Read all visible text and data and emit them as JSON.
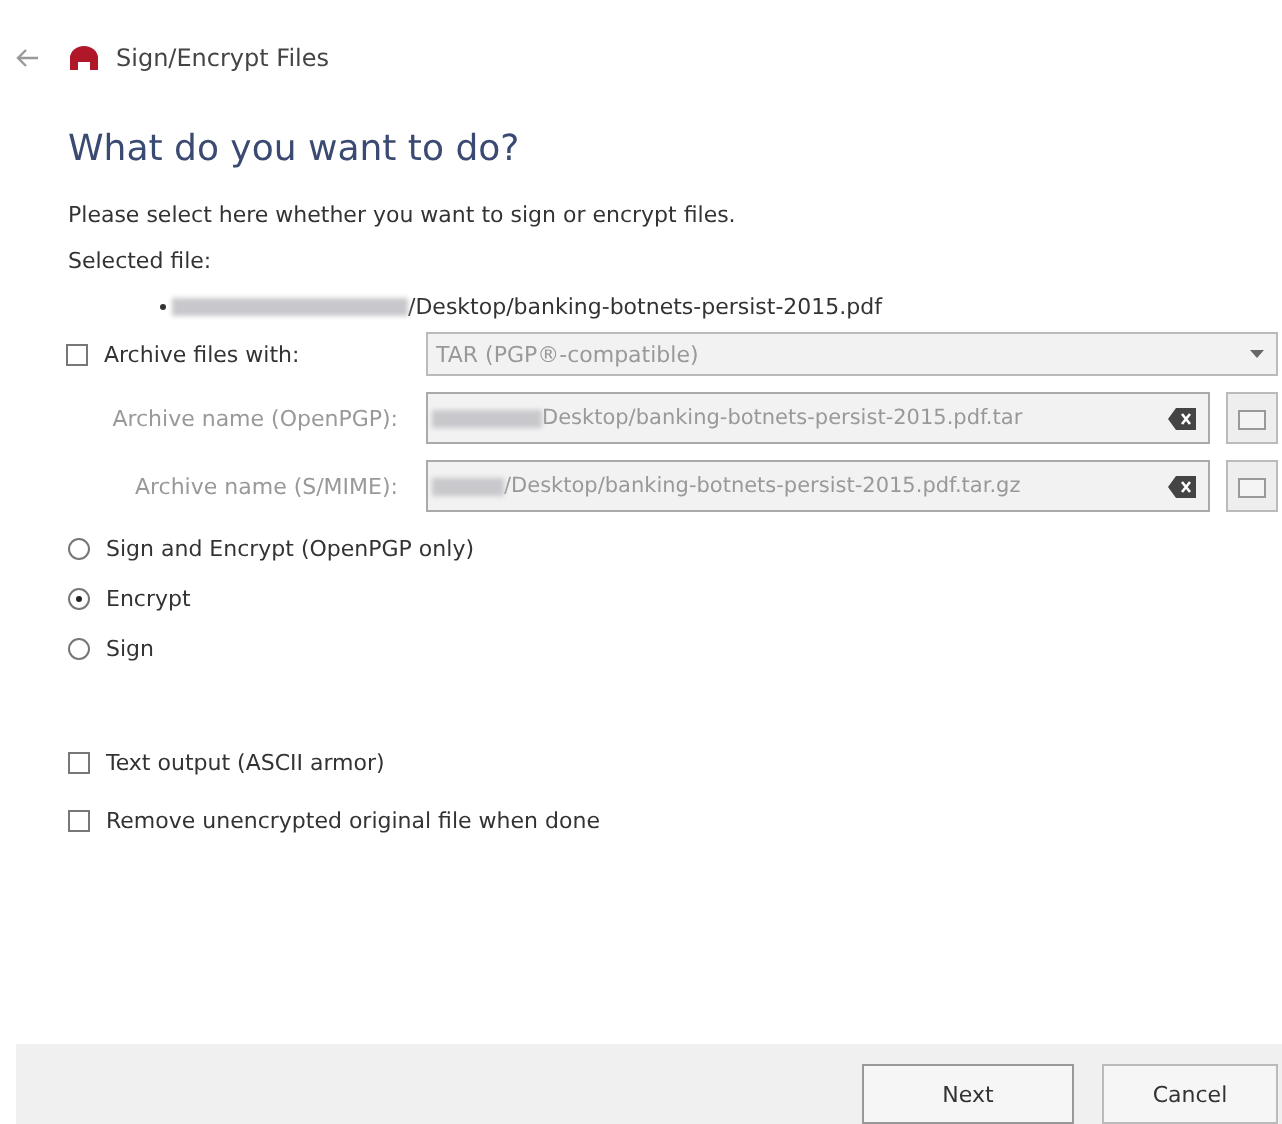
{
  "window": {
    "title": "Sign/Encrypt Files"
  },
  "heading": "What do you want to do?",
  "intro": "Please select here whether you want to sign or encrypt files.",
  "selected_file_label": "Selected file:",
  "selected_files": [
    "/Desktop/banking-botnets-persist-2015.pdf"
  ],
  "archive": {
    "label": "Archive files with:",
    "checked": false,
    "format": "TAR (PGP®-compatible)",
    "disabled": true
  },
  "archive_names": [
    {
      "label": "Archive name (OpenPGP):",
      "value": "Desktop/banking-botnets-persist-2015.pdf.tar",
      "disabled": true
    },
    {
      "label": "Archive name (S/MIME):",
      "value": "/Desktop/banking-botnets-persist-2015.pdf.tar.gz",
      "disabled": true
    }
  ],
  "modes": [
    {
      "label": "Sign and Encrypt (OpenPGP only)",
      "selected": false
    },
    {
      "label": "Encrypt",
      "selected": true
    },
    {
      "label": "Sign",
      "selected": false
    }
  ],
  "options": [
    {
      "label": "Text output (ASCII armor)",
      "checked": false
    },
    {
      "label": "Remove unencrypted original file when done",
      "checked": false
    }
  ],
  "buttons": [
    "Next",
    "Cancel"
  ]
}
